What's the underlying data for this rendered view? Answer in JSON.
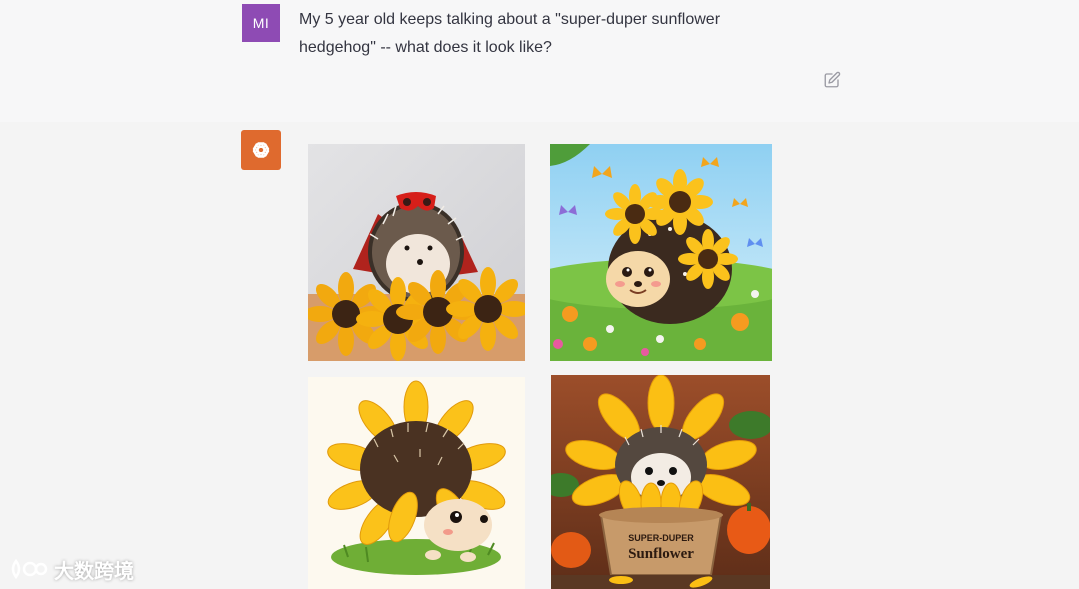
{
  "user_message": {
    "avatar_initials": "MI",
    "text": "My 5 year old keeps talking about a \"super-duper sunflower hedgehog\" -- what does it look like?",
    "edit_icon": "edit-icon"
  },
  "assistant": {
    "avatar_icon": "openai-logo-icon",
    "images": [
      {
        "label": "hedgehog with red mask and cape on sunflowers"
      },
      {
        "label": "cartoon hedgehog with sunflowers in a meadow with butterflies"
      },
      {
        "label": "illustrated hedgehog wearing a sunflower"
      },
      {
        "label": "hedgehog inside a sunflower in a pot",
        "pot_text_line1": "SUPER-DUPER",
        "pot_text_line2": "Sunflower"
      }
    ]
  },
  "watermark": {
    "text": "大数跨境"
  },
  "colors": {
    "user_avatar_bg": "#8e4bb4",
    "assistant_avatar_bg": "#df6a2e",
    "background": "#f7f7f8"
  }
}
